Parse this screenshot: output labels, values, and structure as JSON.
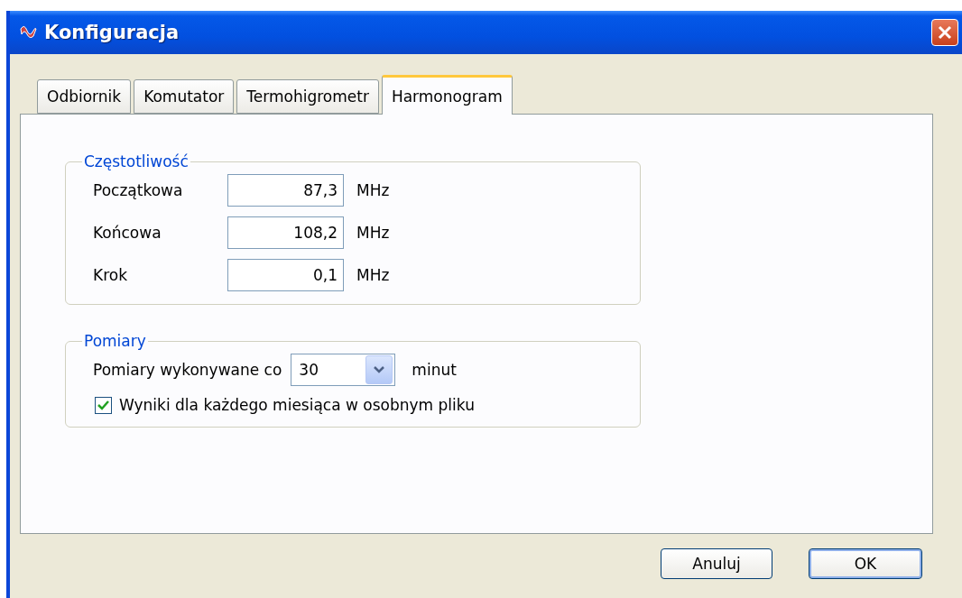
{
  "window": {
    "title": "Konfiguracja"
  },
  "tabs": [
    {
      "label": "Odbiornik",
      "selected": false
    },
    {
      "label": "Komutator",
      "selected": false
    },
    {
      "label": "Termohigrometr",
      "selected": false
    },
    {
      "label": "Harmonogram",
      "selected": true
    }
  ],
  "frequency_group": {
    "title": "Częstotliwość",
    "rows": [
      {
        "label": "Początkowa",
        "value": "87,3",
        "unit": "MHz"
      },
      {
        "label": "Końcowa",
        "value": "108,2",
        "unit": "MHz"
      },
      {
        "label": "Krok",
        "value": "0,1",
        "unit": "MHz"
      }
    ]
  },
  "measurement_group": {
    "title": "Pomiary",
    "interval_label": "Pomiary wykonywane co",
    "interval_value": "30",
    "interval_unit": "minut",
    "monthly_files": {
      "label": "Wyniki dla każdego miesiąca w osobnym pliku",
      "checked": true
    }
  },
  "buttons": [
    {
      "label": "Anuluj",
      "default": false
    },
    {
      "label": "OK",
      "default": true
    }
  ]
}
